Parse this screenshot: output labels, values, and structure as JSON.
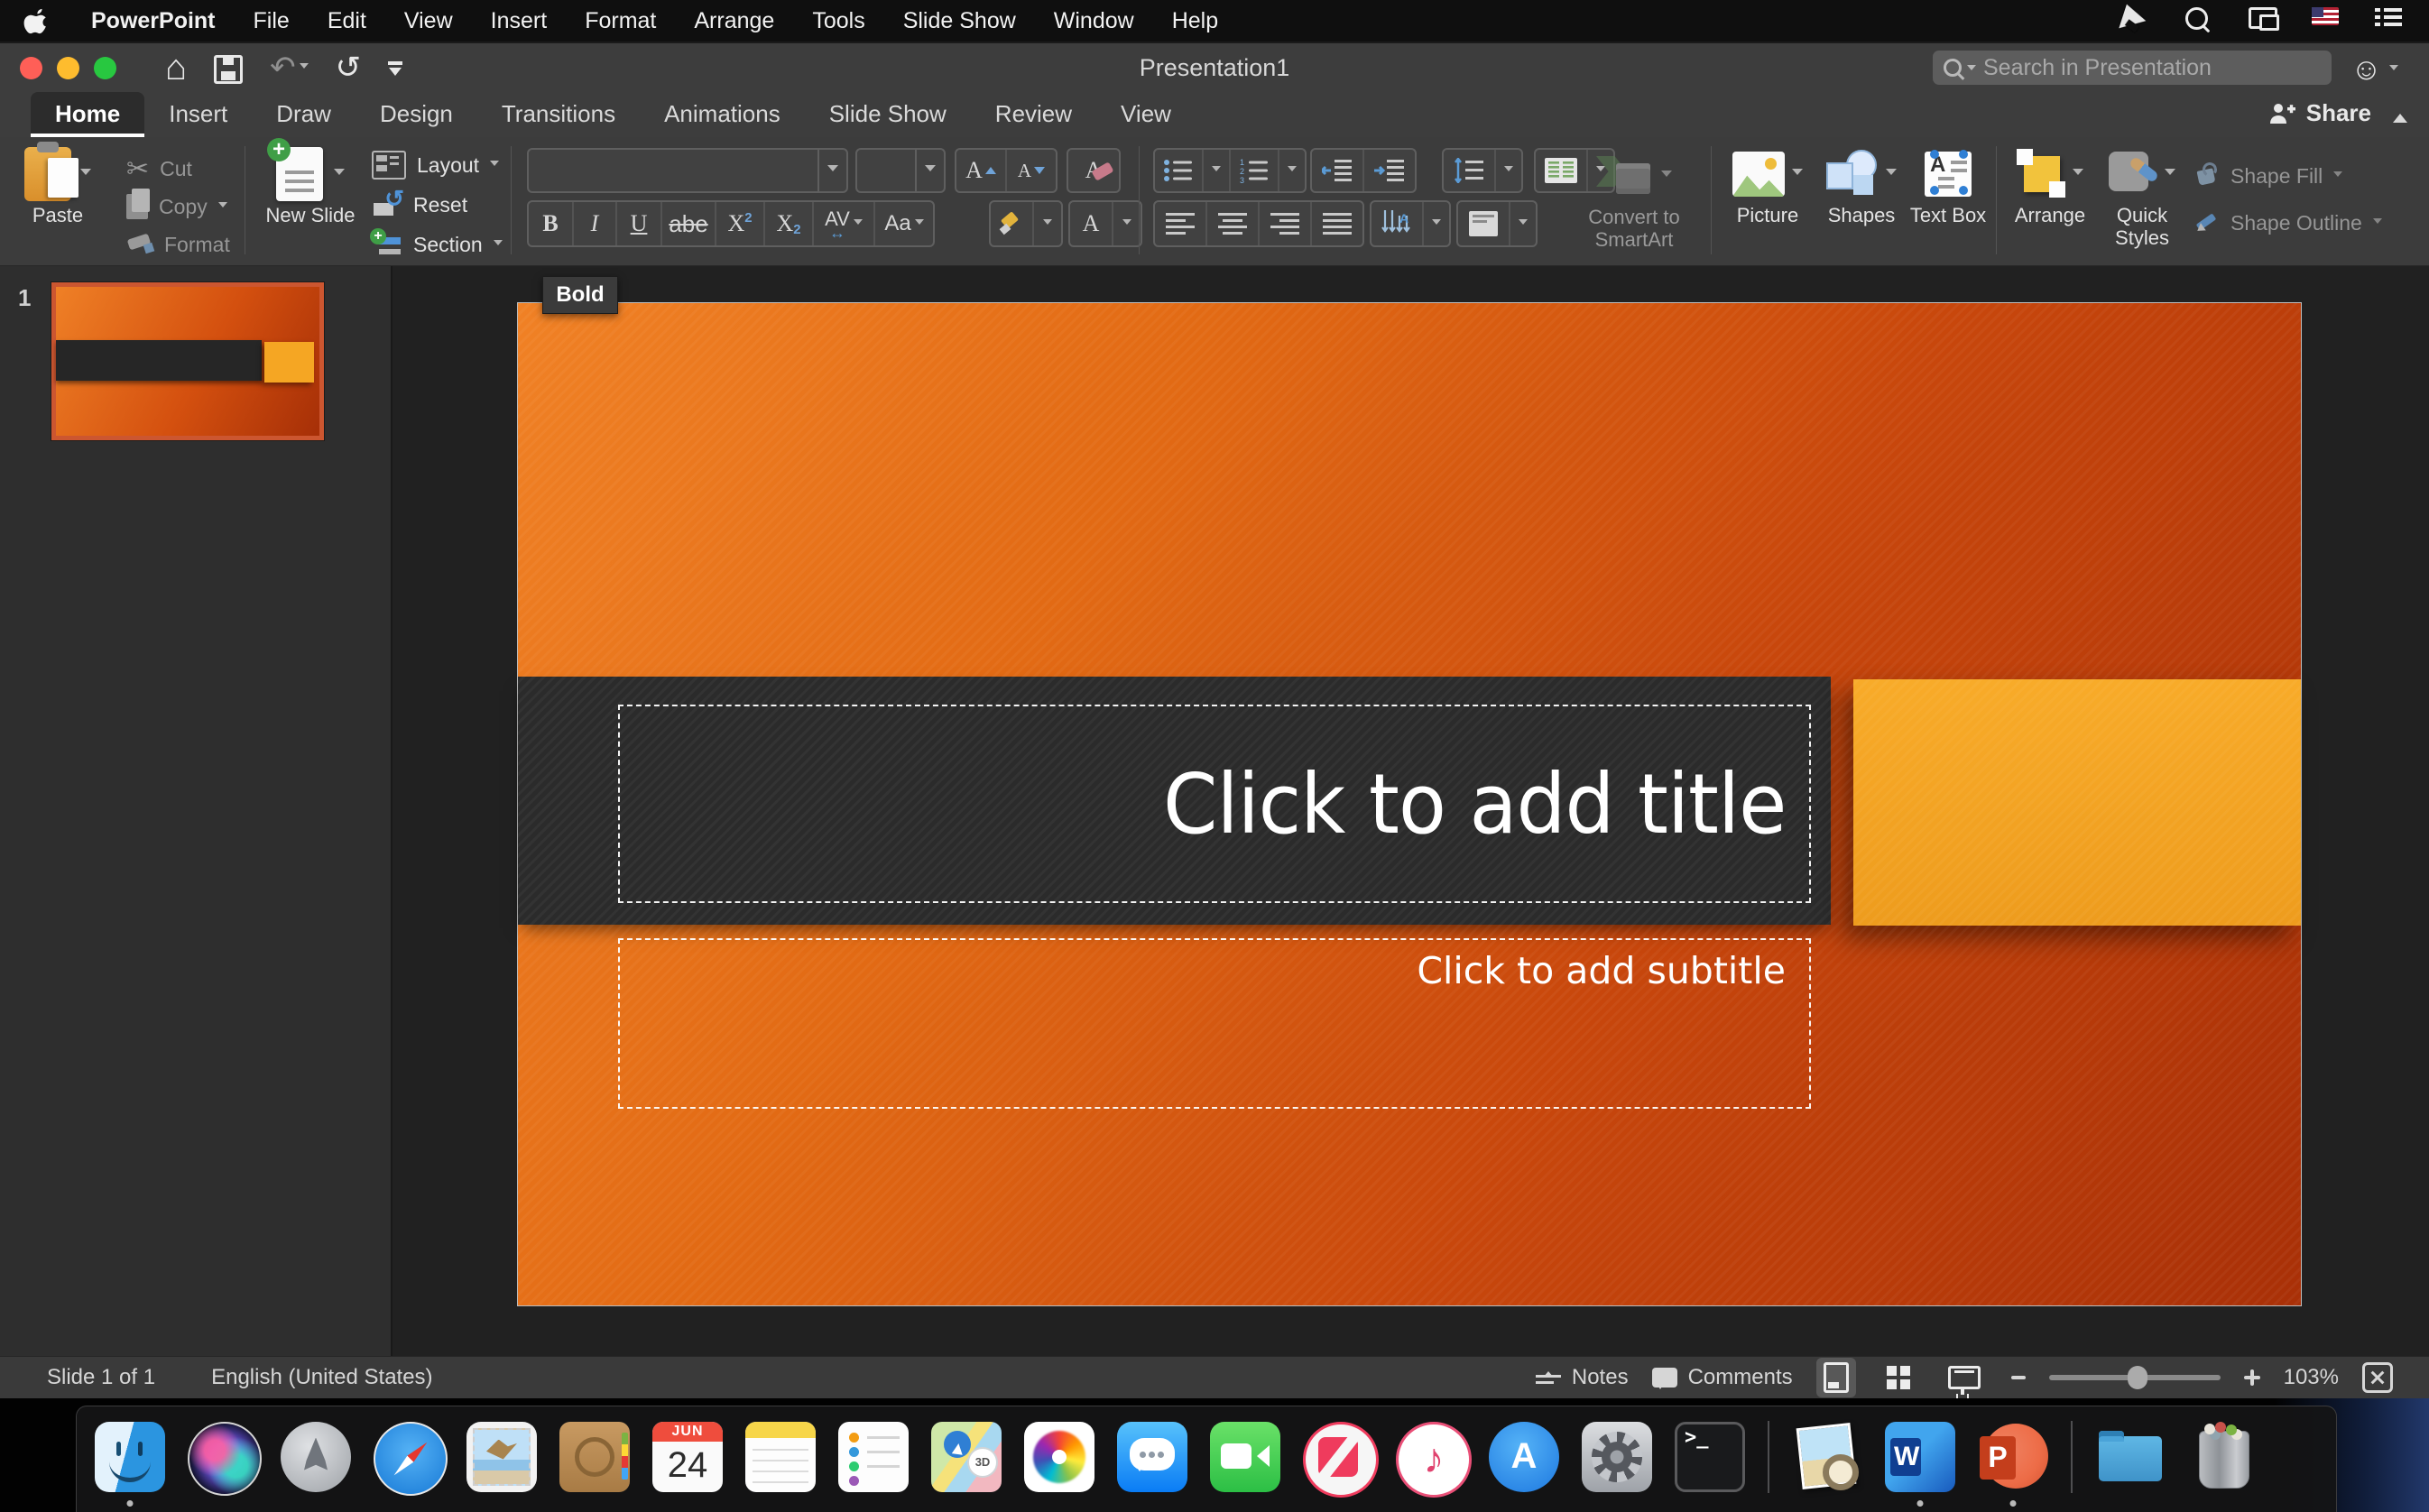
{
  "menu_bar": {
    "items": [
      "PowerPoint",
      "File",
      "Edit",
      "View",
      "Insert",
      "Format",
      "Arrange",
      "Tools",
      "Slide Show",
      "Window",
      "Help"
    ]
  },
  "title_bar": {
    "title": "Presentation1",
    "search_placeholder": "Search in Presentation"
  },
  "tab_bar": {
    "tabs": [
      "Home",
      "Insert",
      "Draw",
      "Design",
      "Transitions",
      "Animations",
      "Slide Show",
      "Review",
      "View"
    ],
    "active_tab": "Home",
    "share": "Share"
  },
  "ribbon": {
    "clipboard": {
      "paste": "Paste",
      "cut": "Cut",
      "copy": "Copy",
      "format": "Format"
    },
    "slides": {
      "new_slide": "New Slide",
      "layout": "Layout",
      "reset": "Reset",
      "section": "Section"
    },
    "font": {
      "bold": "B",
      "italic": "I",
      "underline": "U",
      "strikethrough": "abe",
      "superscript_base": "X",
      "superscript_mark": "2",
      "subscript_base": "X",
      "subscript_mark": "2",
      "char_spacing": "AV",
      "change_case": "Aa",
      "font_color": "A"
    },
    "smartart": {
      "label": "Convert to SmartArt"
    },
    "insert": {
      "picture": "Picture",
      "shapes": "Shapes",
      "text_box": "Text Box"
    },
    "arrange_group": {
      "arrange": "Arrange",
      "quick_styles": "Quick Styles"
    },
    "shape_group": {
      "shape_fill": "Shape Fill",
      "shape_outline": "Shape Outline"
    }
  },
  "tooltip": {
    "text": "Bold"
  },
  "slides_panel": {
    "slide_number": "1"
  },
  "slide": {
    "title_placeholder": "Click to add title",
    "subtitle_placeholder": "Click to add subtitle"
  },
  "status_bar": {
    "slide_indicator": "Slide 1 of 1",
    "language": "English (United States)",
    "notes": "Notes",
    "comments": "Comments",
    "zoom_level": "103%"
  },
  "dock": {
    "items": [
      {
        "name": "finder"
      },
      {
        "name": "siri"
      },
      {
        "name": "launchpad"
      },
      {
        "name": "safari"
      },
      {
        "name": "mail"
      },
      {
        "name": "contacts"
      },
      {
        "name": "calendar",
        "month": "JUN",
        "day": "24"
      },
      {
        "name": "notes"
      },
      {
        "name": "reminders"
      },
      {
        "name": "maps",
        "badge": "3D"
      },
      {
        "name": "photos"
      },
      {
        "name": "messages"
      },
      {
        "name": "facetime"
      },
      {
        "name": "news"
      },
      {
        "name": "itunes"
      },
      {
        "name": "app-store",
        "letter": "A"
      },
      {
        "name": "system-preferences"
      },
      {
        "name": "terminal",
        "prompt": ">_"
      },
      {
        "name": "preview"
      },
      {
        "name": "word",
        "letter": "W"
      },
      {
        "name": "powerpoint",
        "letter": "P"
      },
      {
        "name": "documents-folder"
      },
      {
        "name": "trash"
      }
    ]
  },
  "colors": {
    "slide_gradient_start": "#EE7A1C",
    "slide_gradient_end": "#A93007",
    "dark_band": "#2B2B2B",
    "accent_rect": "#F5A623",
    "selection_border": "#CC5630",
    "ribbon_bg": "#3C3C3C",
    "menu_bar_bg": "#0F0F0F"
  }
}
